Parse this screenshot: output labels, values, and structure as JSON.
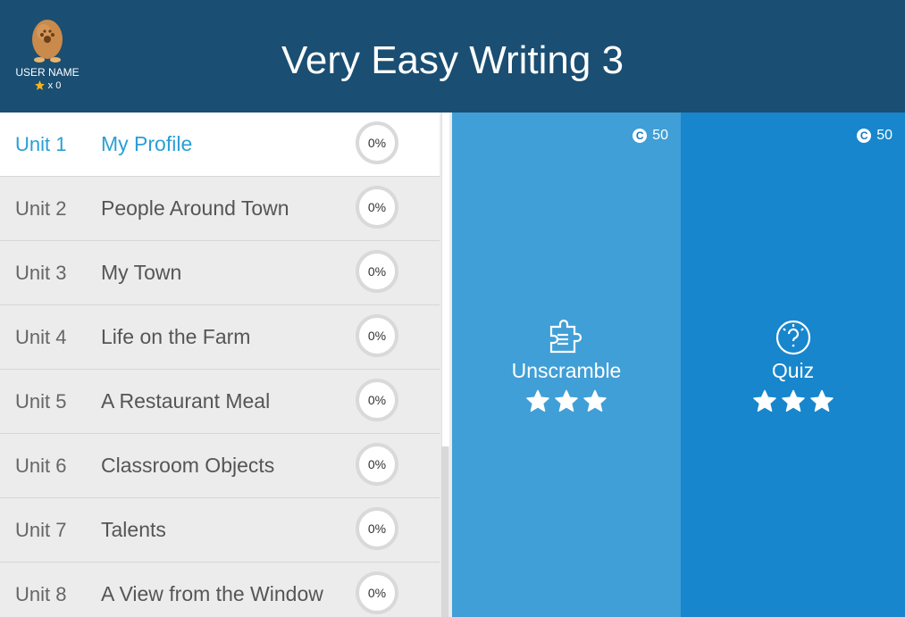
{
  "header": {
    "title": "Very Easy Writing 3",
    "user_name": "USER NAME",
    "star_count": "x 0"
  },
  "units": [
    {
      "number": "Unit 1",
      "title": "My Profile",
      "progress": "0%",
      "active": true
    },
    {
      "number": "Unit 2",
      "title": "People Around Town",
      "progress": "0%"
    },
    {
      "number": "Unit 3",
      "title": "My Town",
      "progress": "0%"
    },
    {
      "number": "Unit 4",
      "title": "Life on the Farm",
      "progress": "0%"
    },
    {
      "number": "Unit 5",
      "title": "A Restaurant Meal",
      "progress": "0%"
    },
    {
      "number": "Unit 6",
      "title": "Classroom Objects",
      "progress": "0%"
    },
    {
      "number": "Unit 7",
      "title": "Talents",
      "progress": "0%"
    },
    {
      "number": "Unit 8",
      "title": "A View from the Window",
      "progress": "0%"
    }
  ],
  "activities": [
    {
      "label": "Unscramble",
      "coins": "50",
      "icon": "puzzle-icon",
      "stars": 3
    },
    {
      "label": "Quiz",
      "coins": "50",
      "icon": "question-bulb-icon",
      "stars": 3
    }
  ],
  "colors": {
    "header_bg": "#1a4e72",
    "active_unit": "#2a9fd6",
    "unscramble_bg": "#409fd6",
    "quiz_bg": "#1786cc",
    "star_gold": "#f5b21a"
  }
}
